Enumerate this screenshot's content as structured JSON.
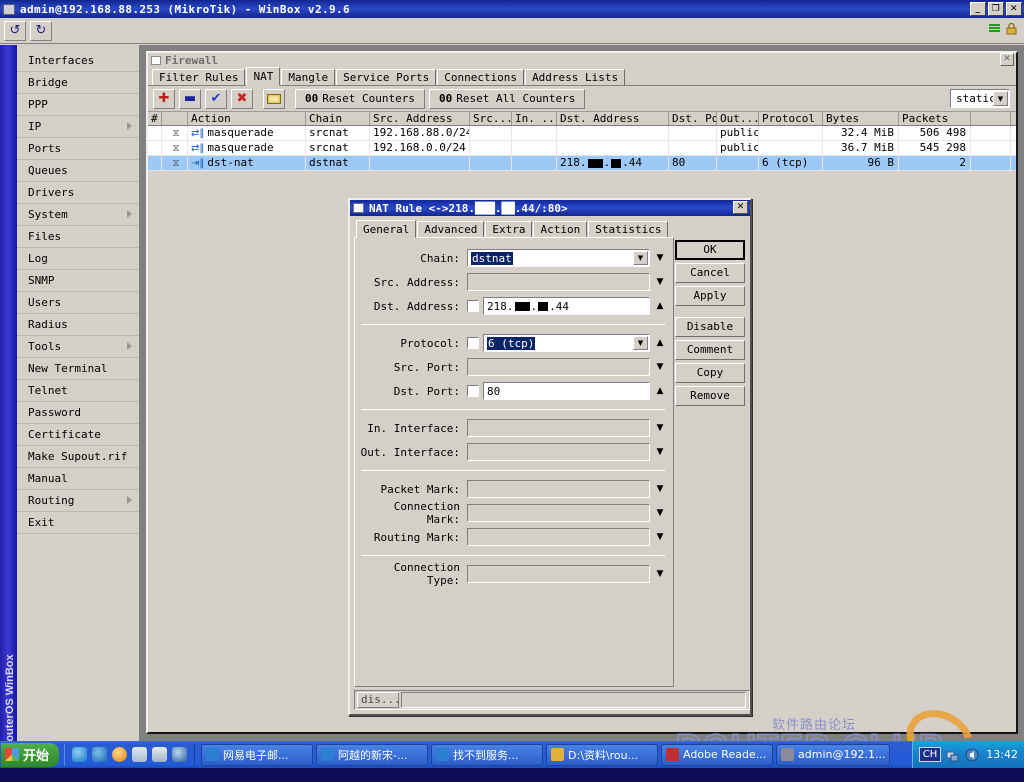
{
  "window": {
    "title": "admin@192.168.88.253 (MikroTik) - WinBox v2.9.6",
    "minimize_label": "_",
    "maximize_label": "❐",
    "close_label": "✕",
    "vertical_brand": "RouterOS WinBox"
  },
  "toolbar": {
    "undo_icon": "↺",
    "redo_icon": "↻"
  },
  "sidebar": {
    "items": [
      {
        "label": "Interfaces",
        "submenu": false
      },
      {
        "label": "Bridge",
        "submenu": false
      },
      {
        "label": "PPP",
        "submenu": false
      },
      {
        "label": "IP",
        "submenu": true
      },
      {
        "label": "Ports",
        "submenu": false
      },
      {
        "label": "Queues",
        "submenu": false
      },
      {
        "label": "Drivers",
        "submenu": false
      },
      {
        "label": "System",
        "submenu": true
      },
      {
        "label": "Files",
        "submenu": false
      },
      {
        "label": "Log",
        "submenu": false
      },
      {
        "label": "SNMP",
        "submenu": false
      },
      {
        "label": "Users",
        "submenu": false
      },
      {
        "label": "Radius",
        "submenu": false
      },
      {
        "label": "Tools",
        "submenu": true
      },
      {
        "label": "New Terminal",
        "submenu": false
      },
      {
        "label": "Telnet",
        "submenu": false
      },
      {
        "label": "Password",
        "submenu": false
      },
      {
        "label": "Certificate",
        "submenu": false
      },
      {
        "label": "Make Supout.rif",
        "submenu": false
      },
      {
        "label": "Manual",
        "submenu": false
      },
      {
        "label": "Routing",
        "submenu": true
      },
      {
        "label": "Exit",
        "submenu": false
      }
    ]
  },
  "firewall": {
    "title": "Firewall",
    "close_label": "✕",
    "tabs": [
      {
        "label": "Filter Rules",
        "active": false
      },
      {
        "label": "NAT",
        "active": true
      },
      {
        "label": "Mangle",
        "active": false
      },
      {
        "label": "Service Ports",
        "active": false
      },
      {
        "label": "Connections",
        "active": false
      },
      {
        "label": "Address Lists",
        "active": false
      }
    ],
    "buttons": {
      "add_icon": "✚",
      "remove_icon": "▬",
      "enable_icon": "✔",
      "disable_icon": "✖",
      "comment_icon": "▭",
      "reset_counters": "Reset Counters",
      "reset_all_counters": "Reset All Counters",
      "counter_prefix": "00"
    },
    "filter_select": {
      "value": "static",
      "arrow": "▼"
    },
    "columns": [
      "#",
      "",
      "Action",
      "Chain",
      "Src. Address",
      "Src...",
      "In. ...",
      "Dst. Address",
      "Dst. Port",
      "Out....",
      "Protocol",
      "Bytes",
      "Packets",
      ""
    ],
    "rows": [
      {
        "num": "",
        "marker": "⧖",
        "action_icon": "⇄‖",
        "action": "masquerade",
        "chain": "srcnat",
        "src_address": "192.168.88.0/24",
        "src_port": "",
        "in_interface": "",
        "dst_address": "",
        "dst_port": "",
        "out_interface": "public",
        "protocol": "",
        "bytes": "32.4 MiB",
        "packets": "506 498",
        "selected": false
      },
      {
        "num": "",
        "marker": "⧖",
        "action_icon": "⇄‖",
        "action": "masquerade",
        "chain": "srcnat",
        "src_address": "192.168.0.0/24",
        "src_port": "",
        "in_interface": "",
        "dst_address": "",
        "dst_port": "",
        "out_interface": "public",
        "protocol": "",
        "bytes": "36.7 MiB",
        "packets": "545 298",
        "selected": false
      },
      {
        "num": "",
        "marker": "⧖",
        "action_icon": "⇥‖",
        "action": "dst-nat",
        "chain": "dstnat",
        "src_address": "",
        "src_port": "",
        "in_interface": "",
        "dst_address": "218.███.██.44",
        "dst_port": "80",
        "out_interface": "",
        "protocol": "6 (tcp)",
        "bytes": "96 B",
        "packets": "2",
        "selected": true
      }
    ]
  },
  "nat_dialog": {
    "title": "NAT Rule <->218.███.██.44/:80>",
    "close_label": "✕",
    "tabs": [
      {
        "label": "General",
        "active": true
      },
      {
        "label": "Advanced",
        "active": false
      },
      {
        "label": "Extra",
        "active": false
      },
      {
        "label": "Action",
        "active": false
      },
      {
        "label": "Statistics",
        "active": false
      }
    ],
    "fields": [
      {
        "label": "Chain:",
        "value": "dstnat",
        "selected": true,
        "checkbox": false,
        "dropdown": true,
        "spinner": false,
        "disabled": false
      },
      {
        "label": "Src. Address:",
        "value": "",
        "selected": false,
        "checkbox": false,
        "dropdown": false,
        "spinner": false,
        "disabled": true,
        "arrow": "▼"
      },
      {
        "label": "Dst. Address:",
        "value": "218.███.██.44",
        "selected": false,
        "checkbox": true,
        "dropdown": false,
        "spinner": true,
        "disabled": false,
        "arrow": "▲"
      },
      {
        "label": "Protocol:",
        "value": "6 (tcp)",
        "selected": true,
        "checkbox": true,
        "dropdown": true,
        "spinner": true,
        "disabled": false,
        "arrow": "▲"
      },
      {
        "label": "Src. Port:",
        "value": "",
        "selected": false,
        "checkbox": false,
        "dropdown": false,
        "spinner": false,
        "disabled": true,
        "arrow": "▼"
      },
      {
        "label": "Dst. Port:",
        "value": "80",
        "selected": false,
        "checkbox": true,
        "dropdown": false,
        "spinner": true,
        "disabled": false,
        "arrow": "▲"
      },
      {
        "label": "In. Interface:",
        "value": "",
        "selected": false,
        "checkbox": false,
        "dropdown": false,
        "spinner": false,
        "disabled": true,
        "arrow": "▼"
      },
      {
        "label": "Out. Interface:",
        "value": "",
        "selected": false,
        "checkbox": false,
        "dropdown": false,
        "spinner": false,
        "disabled": true,
        "arrow": "▼"
      },
      {
        "label": "Packet Mark:",
        "value": "",
        "selected": false,
        "checkbox": false,
        "dropdown": false,
        "spinner": false,
        "disabled": true,
        "arrow": "▼"
      },
      {
        "label": "Connection Mark:",
        "value": "",
        "selected": false,
        "checkbox": false,
        "dropdown": false,
        "spinner": false,
        "disabled": true,
        "arrow": "▼"
      },
      {
        "label": "Routing Mark:",
        "value": "",
        "selected": false,
        "checkbox": false,
        "dropdown": false,
        "spinner": false,
        "disabled": true,
        "arrow": "▼"
      },
      {
        "label": "Connection Type:",
        "value": "",
        "selected": false,
        "checkbox": false,
        "dropdown": false,
        "spinner": false,
        "disabled": true,
        "arrow": "▼"
      }
    ],
    "buttons": [
      {
        "label": "OK",
        "default": true
      },
      {
        "label": "Cancel",
        "default": false
      },
      {
        "label": "Apply",
        "default": false
      },
      {
        "label": "Disable",
        "default": false
      },
      {
        "label": "Comment",
        "default": false
      },
      {
        "label": "Copy",
        "default": false
      },
      {
        "label": "Remove",
        "default": false
      }
    ],
    "status": "dis..."
  },
  "watermark": {
    "chinese": "软件路由论坛",
    "logo": "ROUTER CLUB"
  },
  "taskbar": {
    "start_label": "开始",
    "tasks": [
      {
        "label": "网易电子邮..."
      },
      {
        "label": "阿越的新宋-..."
      },
      {
        "label": "找不到服务..."
      },
      {
        "label": "D:\\资料\\rou..."
      },
      {
        "label": "Adobe Reade..."
      },
      {
        "label": "admin@192.1..."
      }
    ],
    "ime_label": "CH",
    "clock": "13:42"
  }
}
